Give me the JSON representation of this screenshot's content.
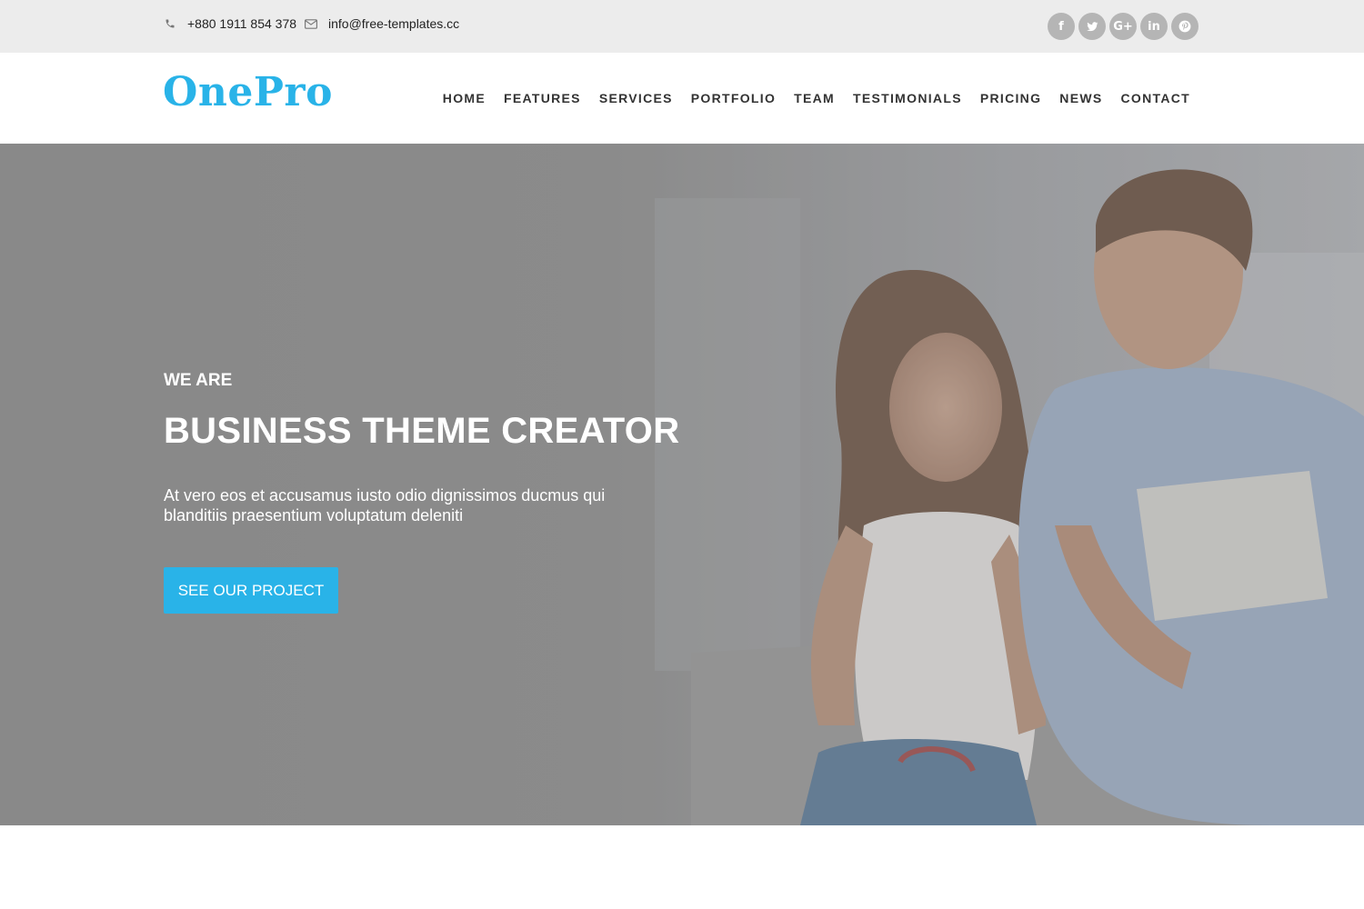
{
  "topbar": {
    "phone": "+880 1911 854 378",
    "phone_icon": "phone-icon",
    "email": "info@free-templates.cc",
    "email_icon": "envelope-icon",
    "socials": [
      {
        "name": "facebook-icon",
        "glyph": "f"
      },
      {
        "name": "twitter-icon",
        "glyph": "t"
      },
      {
        "name": "google-plus-icon",
        "glyph": "G+"
      },
      {
        "name": "linkedin-icon",
        "glyph": "in"
      },
      {
        "name": "pinterest-icon",
        "glyph": "p"
      }
    ]
  },
  "header": {
    "logo": "OnePro",
    "nav": [
      "HOME",
      "FEATURES",
      "SERVICES",
      "PORTFOLIO",
      "TEAM",
      "TESTIMONIALS",
      "PRICING",
      "NEWS",
      "CONTACT"
    ]
  },
  "hero": {
    "eyebrow": "WE ARE",
    "title": "BUSINESS THEME CREATOR",
    "text": "At vero eos et accusamus iusto odio dignissimos ducmus qui blanditiis praesentium voluptatum deleniti",
    "button": "SEE OUR PROJECT"
  },
  "colors": {
    "accent": "#29b3e8",
    "topbar_bg": "#ececec",
    "social_bg": "#b5b5b5"
  }
}
